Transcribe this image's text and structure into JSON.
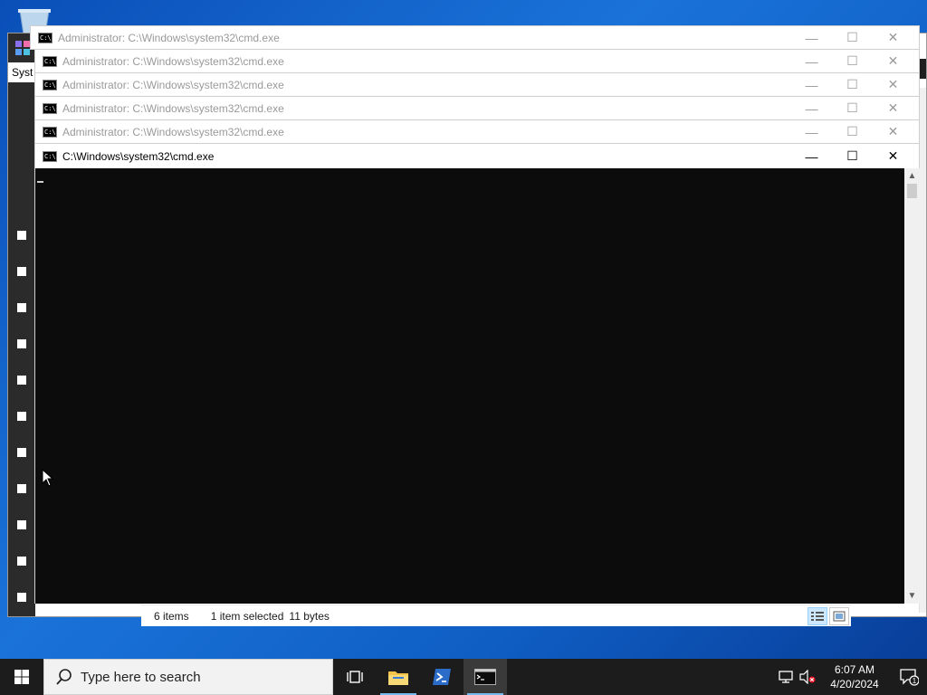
{
  "explorer": {
    "tab_label": "Syst",
    "status": {
      "items": "6 items",
      "selected": "1 item selected",
      "size": "11 bytes"
    }
  },
  "cmd_windows": [
    {
      "title": "Administrator: C:\\Windows\\system32\\cmd.exe",
      "active": false
    },
    {
      "title": "Administrator: C:\\Windows\\system32\\cmd.exe",
      "active": false
    },
    {
      "title": "Administrator: C:\\Windows\\system32\\cmd.exe",
      "active": false
    },
    {
      "title": "Administrator: C:\\Windows\\system32\\cmd.exe",
      "active": false
    },
    {
      "title": "Administrator: C:\\Windows\\system32\\cmd.exe",
      "active": false
    },
    {
      "title": "C:\\Windows\\system32\\cmd.exe",
      "active": true
    }
  ],
  "window_controls": {
    "minimize": "—",
    "maximize": "☐",
    "close": "✕"
  },
  "console": {
    "scroll_up": "▲",
    "scroll_down": "▼"
  },
  "taskbar": {
    "search_placeholder": "Type here to search",
    "clock_time": "6:07 AM",
    "clock_date": "4/20/2024",
    "notification_count": "1"
  },
  "colors": {
    "desktop": "#1a73d9",
    "console_bg": "#0c0c0c",
    "taskbar_bg": "#1c1c1c",
    "running_indicator": "#76b9ed"
  }
}
